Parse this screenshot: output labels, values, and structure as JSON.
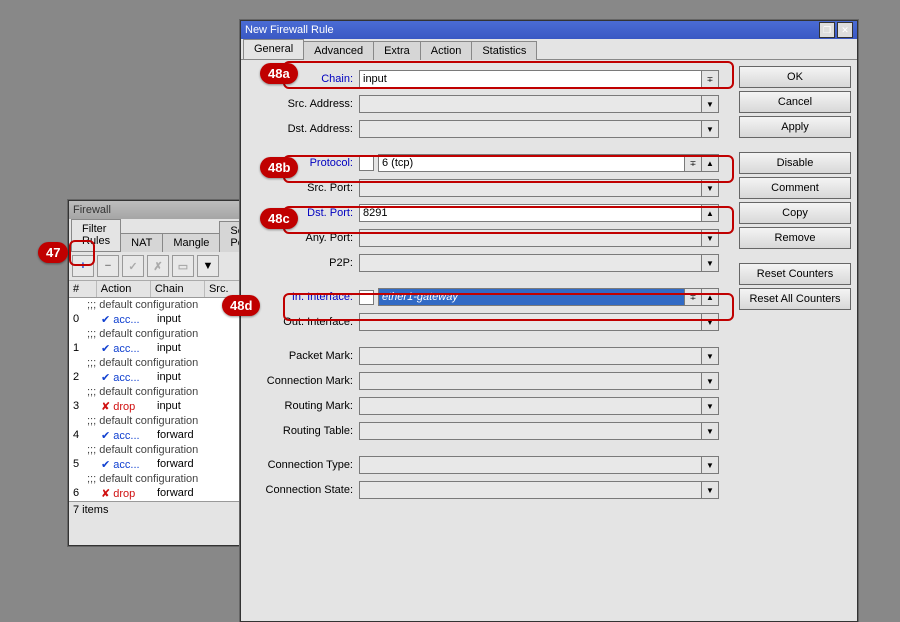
{
  "callouts": {
    "c47": "47",
    "c48a": "48a",
    "c48b": "48b",
    "c48c": "48c",
    "c48d": "48d"
  },
  "fw": {
    "title": "Firewall",
    "tabs": [
      "Filter Rules",
      "NAT",
      "Mangle",
      "Service Ports"
    ],
    "tools": {
      "add": "+",
      "remove": "−",
      "enable": "✓",
      "disable": "✗",
      "comment": "▭",
      "filter": "▼"
    },
    "cols": {
      "n": "#",
      "action": "Action",
      "chain": "Chain",
      "src": "Src."
    },
    "comment": ";;; default configuration",
    "rules": [
      {
        "n": "0",
        "act": "acc...",
        "actk": "acc",
        "chain": "input"
      },
      {
        "n": "1",
        "act": "acc...",
        "actk": "acc",
        "chain": "input"
      },
      {
        "n": "2",
        "act": "acc...",
        "actk": "acc",
        "chain": "input"
      },
      {
        "n": "3",
        "act": "drop",
        "actk": "drop",
        "chain": "input"
      },
      {
        "n": "4",
        "act": "acc...",
        "actk": "acc",
        "chain": "forward"
      },
      {
        "n": "5",
        "act": "acc...",
        "actk": "acc",
        "chain": "forward"
      },
      {
        "n": "6",
        "act": "drop",
        "actk": "drop",
        "chain": "forward"
      }
    ],
    "footer": "7 items"
  },
  "dlg": {
    "title": "New Firewall Rule",
    "tabs": [
      "General",
      "Advanced",
      "Extra",
      "Action",
      "Statistics"
    ],
    "fields": {
      "chain": {
        "label": "Chain:",
        "value": "input"
      },
      "srcaddr": {
        "label": "Src. Address:",
        "value": ""
      },
      "dstaddr": {
        "label": "Dst. Address:",
        "value": ""
      },
      "proto": {
        "label": "Protocol:",
        "value": "6 (tcp)"
      },
      "srcport": {
        "label": "Src. Port:",
        "value": ""
      },
      "dstport": {
        "label": "Dst. Port:",
        "value": "8291"
      },
      "anyport": {
        "label": "Any. Port:",
        "value": ""
      },
      "p2p": {
        "label": "P2P:",
        "value": ""
      },
      "iniface": {
        "label": "In. Interface:",
        "value": "ether1-gateway"
      },
      "outiface": {
        "label": "Out. Interface:",
        "value": ""
      },
      "pktmark": {
        "label": "Packet Mark:",
        "value": ""
      },
      "connmark": {
        "label": "Connection Mark:",
        "value": ""
      },
      "routemark": {
        "label": "Routing Mark:",
        "value": ""
      },
      "routetable": {
        "label": "Routing Table:",
        "value": ""
      },
      "conntype": {
        "label": "Connection Type:",
        "value": ""
      },
      "connstate": {
        "label": "Connection State:",
        "value": ""
      }
    },
    "buttons": {
      "ok": "OK",
      "cancel": "Cancel",
      "apply": "Apply",
      "disable": "Disable",
      "comment": "Comment",
      "copy": "Copy",
      "remove": "Remove",
      "reset": "Reset Counters",
      "resetall": "Reset All Counters"
    }
  }
}
